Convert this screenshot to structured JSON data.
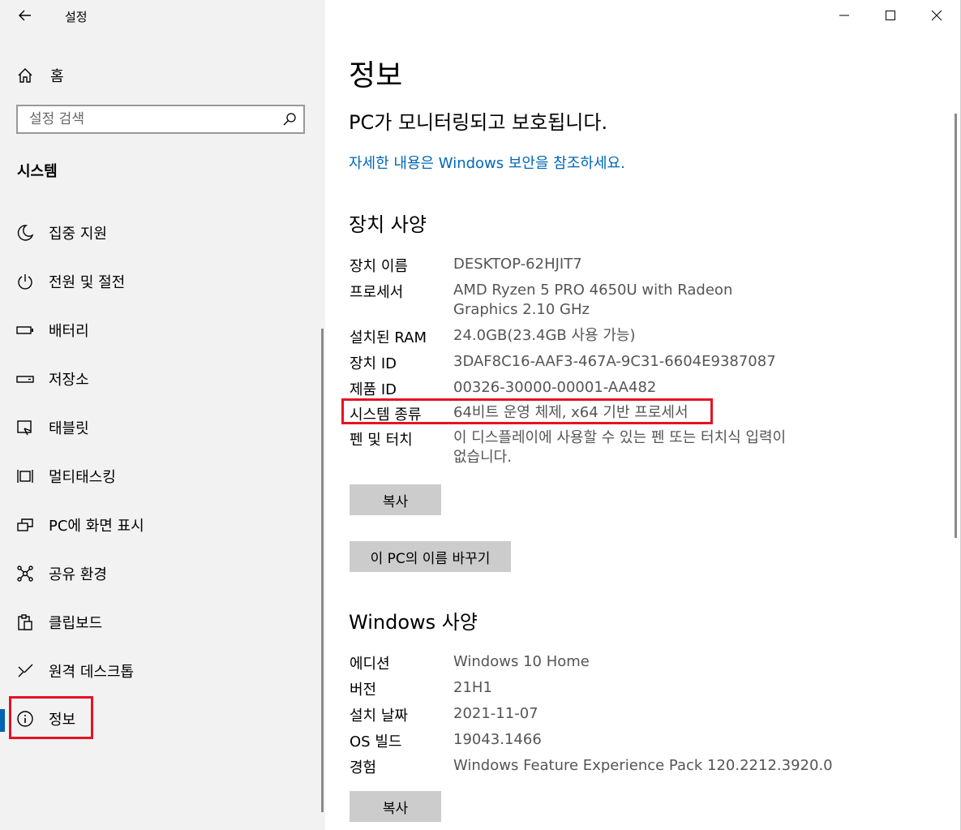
{
  "window": {
    "title": "설정"
  },
  "sidebar": {
    "home_label": "홈",
    "search_placeholder": "설정 검색",
    "section_title": "시스템",
    "items": [
      {
        "label": "집중 지원",
        "icon": "moon-icon"
      },
      {
        "label": "전원 및 절전",
        "icon": "power-icon"
      },
      {
        "label": "배터리",
        "icon": "battery-icon"
      },
      {
        "label": "저장소",
        "icon": "storage-drive-icon"
      },
      {
        "label": "태블릿",
        "icon": "tablet-icon"
      },
      {
        "label": "멀티태스킹",
        "icon": "multitasking-icon"
      },
      {
        "label": "PC에 화면 표시",
        "icon": "project-screen-icon"
      },
      {
        "label": "공유 환경",
        "icon": "shared-experiences-icon"
      },
      {
        "label": "클립보드",
        "icon": "clipboard-icon"
      },
      {
        "label": "원격 데스크톱",
        "icon": "remote-desktop-icon"
      },
      {
        "label": "정보",
        "icon": "info-icon",
        "active": true
      }
    ]
  },
  "main": {
    "page_title": "정보",
    "protection_status": "PC가 모니터링되고 보호됩니다.",
    "security_link": "자세한 내용은 Windows 보안을 참조하세요.",
    "device_specs": {
      "title": "장치 사양",
      "rows": [
        {
          "key": "장치 이름",
          "value": "DESKTOP-62HJIT7"
        },
        {
          "key": "프로세서",
          "value": "AMD Ryzen 5 PRO 4650U with Radeon Graphics 2.10 GHz"
        },
        {
          "key": "설치된 RAM",
          "value": "24.0GB(23.4GB 사용 가능)"
        },
        {
          "key": "장치 ID",
          "value": "3DAF8C16-AAF3-467A-9C31-6604E9387087"
        },
        {
          "key": "제품 ID",
          "value": "00326-30000-00001-AA482"
        },
        {
          "key": "시스템 종류",
          "value": "64비트 운영 체제, x64 기반 프로세서"
        },
        {
          "key": "펜 및 터치",
          "value": "이 디스플레이에 사용할 수 있는 펜 또는 터치식 입력이 없습니다."
        }
      ],
      "copy_label": "복사",
      "rename_label": "이 PC의 이름 바꾸기"
    },
    "windows_specs": {
      "title": "Windows 사양",
      "rows": [
        {
          "key": "에디션",
          "value": "Windows 10 Home"
        },
        {
          "key": "버전",
          "value": "21H1"
        },
        {
          "key": "설치 날짜",
          "value": "2021-11-07"
        },
        {
          "key": "OS 빌드",
          "value": "19043.1466"
        },
        {
          "key": "경험",
          "value": "Windows Feature Experience Pack 120.2212.3920.0"
        }
      ],
      "copy_label": "복사"
    }
  },
  "colors": {
    "accent": "#0063b1",
    "link": "#0067b8",
    "highlight": "#e81123"
  }
}
